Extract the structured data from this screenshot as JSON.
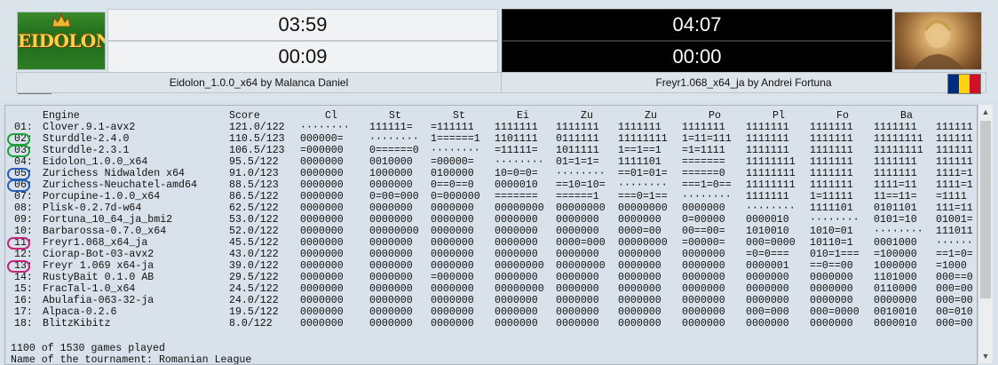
{
  "white_engine": {
    "logo_text": "EIDOLON",
    "clock_total": "03:59",
    "clock_move": "00:09",
    "name": "Eidolon_1.0.0_x64 by Malanca Daniel",
    "flag_colors": [
      "#002b7f",
      "#fcd116",
      "#ce1126"
    ]
  },
  "black_engine": {
    "clock_total": "04:07",
    "clock_move": "00:00",
    "name": "Freyr1.068_x64_ja by Andrei Fortuna",
    "flag_colors": [
      "#002b7f",
      "#fcd116",
      "#ce1126"
    ]
  },
  "table": {
    "headers": [
      "Engine",
      "Score",
      "Cl",
      "St",
      "St",
      "Ei",
      "Zu",
      "Zu",
      "Po",
      "Pl",
      "Fo",
      "Ba"
    ],
    "rows": [
      {
        "rank": "01:",
        "engine": "Clover.9.1-avx2",
        "score": "121.0/122",
        "cells": [
          "········",
          "111111=",
          "=111111",
          "1111111",
          "1111111",
          "1111111",
          "1111111",
          "1111111",
          "1111111",
          "1111111",
          "111111"
        ]
      },
      {
        "rank": "02:",
        "engine": "Sturddle-2.4.0",
        "score": "110.5/123",
        "cells": [
          "000000=",
          "········",
          "1======1",
          "1101111",
          "0111111",
          "11111111",
          "1=11=111",
          "1111111",
          "1111111",
          "11111111",
          "111111"
        ]
      },
      {
        "rank": "03:",
        "engine": "Sturddle-2.3.1",
        "score": "106.5/123",
        "cells": [
          "=000000",
          "0======0",
          "········",
          "=11111=",
          "1011111",
          "1==1==1",
          "=1=1111",
          "1111111",
          "1111111",
          "11111111",
          "111111"
        ]
      },
      {
        "rank": "04:",
        "engine": "Eidolon_1.0.0_x64",
        "score": "95.5/122",
        "cells": [
          "0000000",
          "0010000",
          "=00000=",
          "········",
          "01=1=1=",
          "1111101",
          "=======",
          "11111111",
          "1111111",
          "1111111",
          "111111"
        ]
      },
      {
        "rank": "05:",
        "engine": "Zurichess Nidwalden x64",
        "score": "91.0/123",
        "cells": [
          "0000000",
          "1000000",
          "0100000",
          "10=0=0=",
          "········",
          "==01=01=",
          "======0",
          "11111111",
          "1111111",
          "1111111",
          "1111=1"
        ]
      },
      {
        "rank": "06:",
        "engine": "Zurichess-Neuchatel-amd64",
        "score": "88.5/123",
        "cells": [
          "0000000",
          "0000000",
          "0==0==0",
          "0000010",
          "==10=10=",
          "········",
          "===1=0==",
          "11111111",
          "1111111",
          "1111=11",
          "1111=1"
        ]
      },
      {
        "rank": "07:",
        "engine": "Porcupine-1.0.0_x64",
        "score": "86.5/122",
        "cells": [
          "0000000",
          "0=00=000",
          "0=000000",
          "=======",
          "======1",
          "===0=1==",
          "········",
          "1111111",
          "1=11111",
          "11==11=",
          "=1111"
        ]
      },
      {
        "rank": "08:",
        "engine": "Plisk-0.2.7d-w64",
        "score": "62.5/122",
        "cells": [
          "0000000",
          "0000000",
          "0000000",
          "00000000",
          "00000000",
          "00000000",
          "0000000",
          "········",
          "1111101",
          "0101101",
          "111=11"
        ]
      },
      {
        "rank": "09:",
        "engine": "Fortuna_10_64_ja_bmi2",
        "score": "53.0/122",
        "cells": [
          "0000000",
          "0000000",
          "0000000",
          "0000000",
          "0000000",
          "0000000",
          "0=00000",
          "0000010",
          "········",
          "0101=10",
          "01001="
        ]
      },
      {
        "rank": "10:",
        "engine": "Barbarossa-0.7.0_x64",
        "score": "52.0/122",
        "cells": [
          "0000000",
          "00000000",
          "0000000",
          "0000000",
          "0000000",
          "0000=00",
          "00==00=",
          "1010010",
          "1010=01",
          "········",
          "111011"
        ]
      },
      {
        "rank": "11:",
        "engine": "Freyr1.068_x64_ja",
        "score": "45.5/122",
        "cells": [
          "0000000",
          "0000000",
          "0000000",
          "0000000",
          "0000=000",
          "00000000",
          "=00000=",
          "000=0000",
          "10110=1",
          "0001000",
          "······"
        ]
      },
      {
        "rank": "12:",
        "engine": "Ciorap-Bot-03-avx2",
        "score": "43.0/122",
        "cells": [
          "0000000",
          "0000000",
          "0000000",
          "0000000",
          "0000000",
          "0000000",
          "0000000",
          "=0=0===",
          "010=1===",
          "=100000",
          "==1=0="
        ]
      },
      {
        "rank": "13:",
        "engine": "Freyr 1.069 x64-ja",
        "score": "39.0/122",
        "cells": [
          "0000000",
          "0000000",
          "0000000",
          "00000000",
          "00000000",
          "0000000",
          "0000000",
          "0000001",
          "==0==00",
          "1000000",
          "=1000"
        ]
      },
      {
        "rank": "14:",
        "engine": "RustyBait 0.1.0 AB",
        "score": "29.5/122",
        "cells": [
          "0000000",
          "0000000",
          "=000000",
          "0000000",
          "0000000",
          "0000000",
          "0000000",
          "0000000",
          "0000000",
          "1101000",
          "000==0"
        ]
      },
      {
        "rank": "15:",
        "engine": "FracTal-1.0_x64",
        "score": "24.5/122",
        "cells": [
          "0000000",
          "0000000",
          "0000000",
          "00000000",
          "0000000",
          "0000000",
          "0000000",
          "0000000",
          "0000000",
          "0110000",
          "000=00"
        ]
      },
      {
        "rank": "16:",
        "engine": "Abulafia-063-32-ja",
        "score": "24.0/122",
        "cells": [
          "0000000",
          "0000000",
          "0000000",
          "0000000",
          "0000000",
          "0000000",
          "0000000",
          "0000000",
          "0000000",
          "0000000",
          "000=00"
        ]
      },
      {
        "rank": "17:",
        "engine": "Alpaca-0.2.6",
        "score": "19.5/122",
        "cells": [
          "0000000",
          "0000000",
          "0000000",
          "0000000",
          "0000000",
          "0000000",
          "0000000",
          "000=000",
          "000=0000",
          "0010010",
          "00=010"
        ]
      },
      {
        "rank": "18:",
        "engine": "BlitzKibitz",
        "score": "8.0/122",
        "cells": [
          "0000000",
          "0000000",
          "0000000",
          "0000000",
          "0000000",
          "0000000",
          "0000000",
          "0000000",
          "0000000",
          "0000010",
          "000=00"
        ]
      }
    ],
    "highlights": [
      {
        "rank": "02:",
        "color": "#1fa33a"
      },
      {
        "rank": "03:",
        "color": "#1fa33a"
      },
      {
        "rank": "05:",
        "color": "#2a5fb8"
      },
      {
        "rank": "06:",
        "color": "#2a5fb8"
      },
      {
        "rank": "11:",
        "color": "#c8237a"
      },
      {
        "rank": "13:",
        "color": "#c8237a"
      }
    ]
  },
  "footer": {
    "games": "1100 of 1530 games played",
    "tournament": "Name of the tournament: Romanian League"
  }
}
